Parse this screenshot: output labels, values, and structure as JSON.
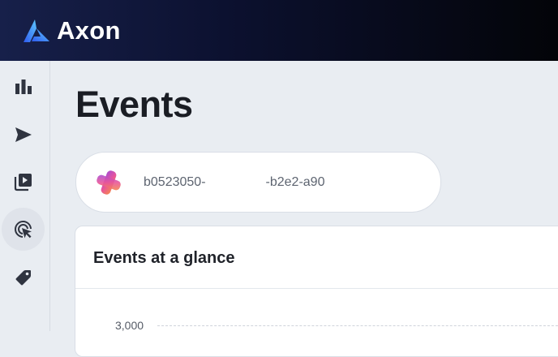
{
  "header": {
    "brand_name": "Axon"
  },
  "sidebar": {
    "items": [
      {
        "name": "analytics",
        "icon": "bar-chart-icon",
        "active": false
      },
      {
        "name": "send",
        "icon": "send-icon",
        "active": false
      },
      {
        "name": "video-library",
        "icon": "video-library-icon",
        "active": false
      },
      {
        "name": "events",
        "icon": "cursor-click-icon",
        "active": true
      },
      {
        "name": "tags",
        "icon": "tag-icon",
        "active": false
      }
    ]
  },
  "page": {
    "title": "Events"
  },
  "app_selector": {
    "app_id_start": "b0523050-",
    "app_id_end": "-b2e2-a90",
    "icon": "app-logo-icon"
  },
  "events_card": {
    "title": "Events at a glance",
    "y_ticks": [
      "3,000"
    ]
  },
  "colors": {
    "header_start": "#17204a",
    "header_end": "#030408",
    "background": "#e9edf2",
    "brand_blue": "#3b6ff5"
  }
}
